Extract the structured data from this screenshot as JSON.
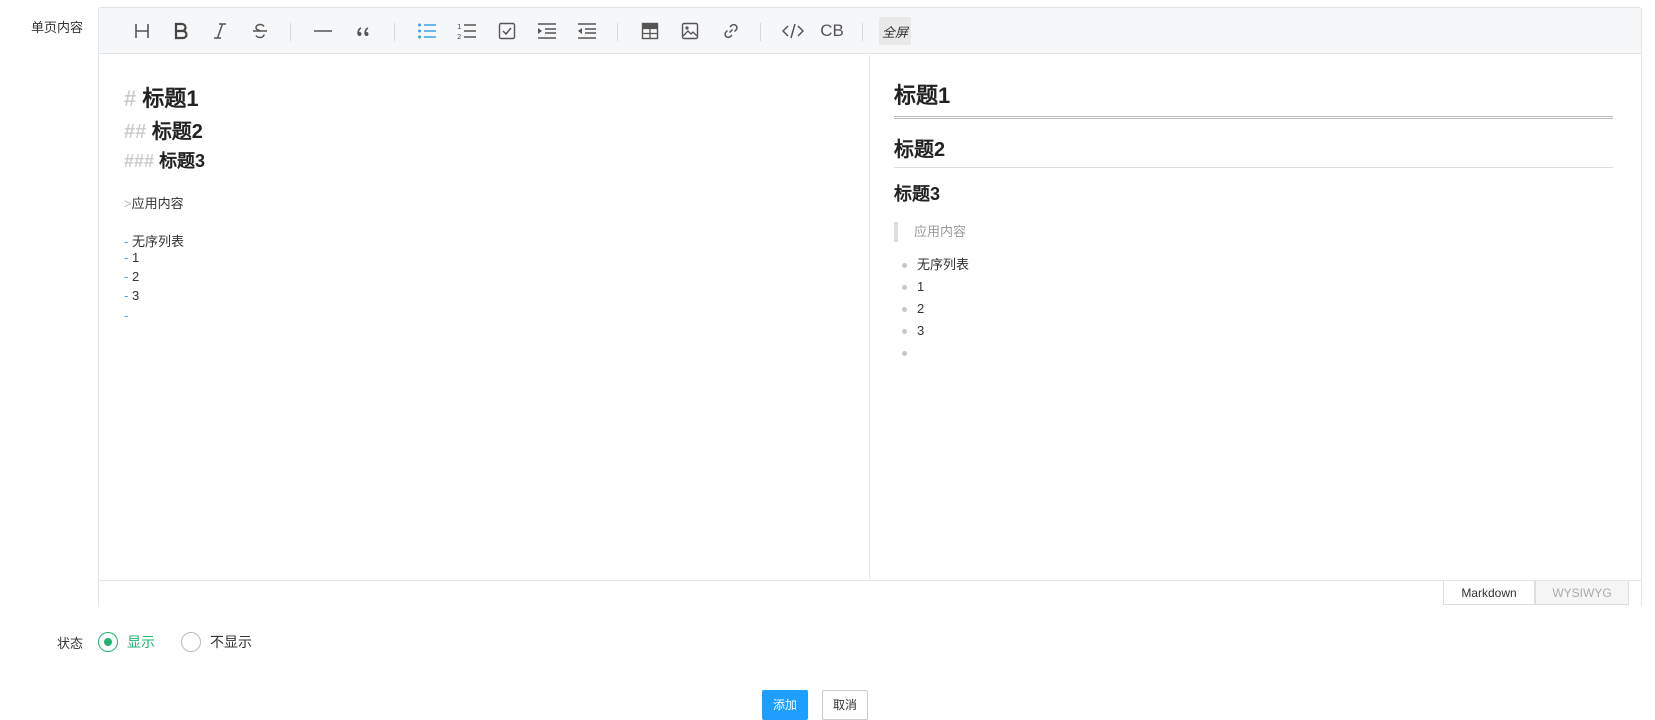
{
  "form": {
    "content_label": "单页内容",
    "status_label": "状态"
  },
  "toolbar": {
    "items": [
      {
        "name": "heading-icon"
      },
      {
        "name": "bold-icon"
      },
      {
        "name": "italic-icon"
      },
      {
        "name": "strikethrough-icon"
      },
      {
        "name": "horizontal-rule-icon"
      },
      {
        "name": "quote-icon"
      },
      {
        "name": "bullet-list-icon"
      },
      {
        "name": "ordered-list-icon"
      },
      {
        "name": "task-list-icon"
      },
      {
        "name": "indent-icon"
      },
      {
        "name": "outdent-icon"
      },
      {
        "name": "table-icon"
      },
      {
        "name": "image-icon"
      },
      {
        "name": "link-icon"
      },
      {
        "name": "code-icon"
      }
    ],
    "code_block_label": "CB",
    "fullscreen_label": "全屏",
    "active_color": "#3aa3e3"
  },
  "markdown": {
    "h1_mark": "#",
    "h1_text": "标题1",
    "h2_mark": "##",
    "h2_text": "标题2",
    "h3_mark": "###",
    "h3_text": "标题3",
    "quote_mark": ">",
    "quote_text": "应用内容",
    "list_mark": "-",
    "list_items": [
      "无序列表",
      "1",
      "2",
      "3",
      ""
    ]
  },
  "preview": {
    "h1": "标题1",
    "h2": "标题2",
    "h3": "标题3",
    "quote": "应用内容",
    "list_items": [
      "无序列表",
      "1",
      "2",
      "3",
      ""
    ]
  },
  "mode_tabs": {
    "markdown": "Markdown",
    "wysiwyg": "WYSIWYG",
    "selected": "Markdown"
  },
  "status": {
    "options": [
      "显示",
      "不显示"
    ],
    "selected": "显示",
    "selected_color": "#22b36e"
  },
  "actions": {
    "add": "添加",
    "cancel": "取消",
    "add_color": "#1e9fff"
  }
}
